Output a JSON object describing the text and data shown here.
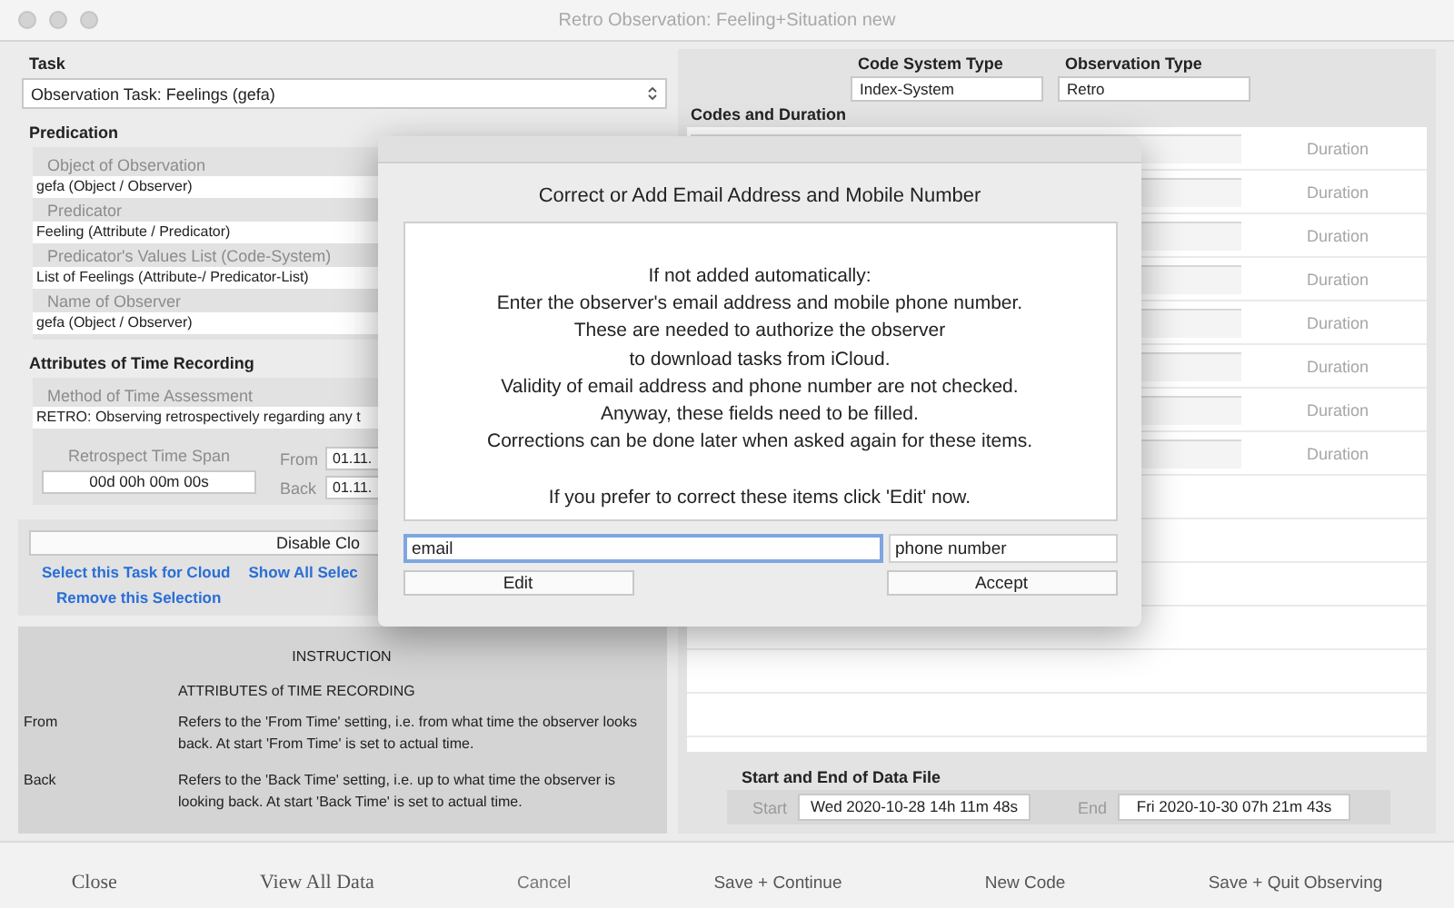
{
  "window": {
    "title": "Retro Observation: Feeling+Situation new"
  },
  "task": {
    "label": "Task",
    "value": "Observation Task: Feelings (gefa)"
  },
  "predication": {
    "title": "Predication",
    "fields": [
      {
        "label": "Object of Observation",
        "value": "gefa (Object / Observer)"
      },
      {
        "label": "Predicator",
        "value": "Feeling (Attribute / Predicator)"
      },
      {
        "label": "Predicator's Values List (Code-System)",
        "value": "List of Feelings (Attribute-/ Predicator-List)"
      },
      {
        "label": "Name of Observer",
        "value": "gefa (Object / Observer)"
      }
    ]
  },
  "time_recording": {
    "title": "Attributes of Time Recording",
    "method_label": "Method of Time Assessment",
    "method_value": "RETRO: Observing retrospectively regarding any t",
    "span_label": "Retrospect Time Span",
    "span_value": "00d 00h 00m 00s",
    "from_label": "From",
    "from_value": "01.11.",
    "back_label": "Back",
    "back_value": "01.11."
  },
  "cloud": {
    "button": "Disable Clo",
    "links": [
      "Select this Task for Cloud",
      "Show All Selec",
      "Remove this Selection"
    ]
  },
  "instruction": {
    "title": "INSTRUCTION",
    "subtitle": "ATTRIBUTES of TIME RECORDING",
    "rows": [
      {
        "term": "From",
        "text": "Refers to the 'From Time' setting, i.e. from what time the observer looks back. At start 'From Time' is set to actual time."
      },
      {
        "term": "Back",
        "text": "Refers to the 'Back Time' setting, i.e. up to what time the observer is looking back. At start 'Back Time' is set to actual time."
      }
    ]
  },
  "code_system_type": {
    "label": "Code System Type",
    "value": "Index-System"
  },
  "observation_type": {
    "label": "Observation Type",
    "value": "Retro"
  },
  "codes": {
    "title": "Codes and Duration",
    "rows": [
      {
        "duration": "Duration"
      },
      {
        "duration": "Duration"
      },
      {
        "duration": "Duration"
      },
      {
        "duration": "Duration"
      },
      {
        "duration": "Duration"
      },
      {
        "duration": "Duration"
      },
      {
        "duration": "Duration"
      },
      {
        "duration": "Duration"
      }
    ]
  },
  "data_file": {
    "title": "Start and End of Data File",
    "start_label": "Start",
    "start_value": "Wed 2020-10-28  14h 11m 48s",
    "end_label": "End",
    "end_value": "Fri 2020-10-30  07h 21m 43s"
  },
  "footer": [
    {
      "label": "Close",
      "kind": "serif"
    },
    {
      "label": "View All Data",
      "kind": "serif"
    },
    {
      "label": "Cancel",
      "kind": "muted"
    },
    {
      "label": "Save + Continue",
      "kind": "sans"
    },
    {
      "label": "New Code",
      "kind": "sans"
    },
    {
      "label": "Save + Quit Observing",
      "kind": "sans"
    }
  ],
  "dialog": {
    "title": "Correct or Add Email Address and Mobile Number",
    "message": [
      "If not added automatically:",
      "Enter the observer's email address and mobile phone number.",
      "These are needed to authorize the observer",
      "to download tasks from iCloud.",
      "Validity of email address and phone number are not checked.",
      "Anyway, these fields need to be filled.",
      "Corrections can be done later when asked again for these items.",
      "If you prefer to correct these items click 'Edit' now."
    ],
    "email": {
      "value": "email",
      "focused": true
    },
    "phone": {
      "value": "phone number",
      "focused": false
    },
    "buttons": [
      "Edit",
      "Accept"
    ]
  }
}
